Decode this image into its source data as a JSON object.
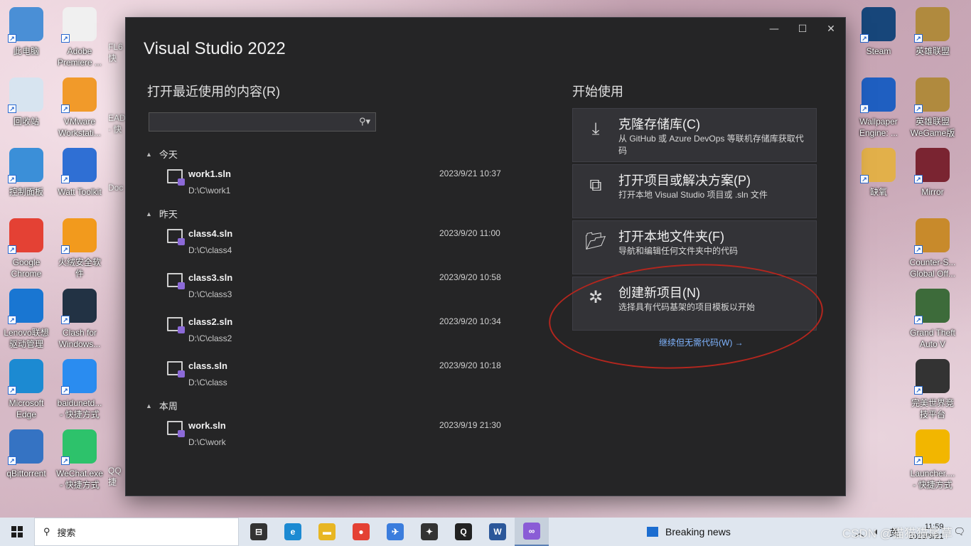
{
  "desktop": {
    "left_icons": [
      {
        "label": "此电脑",
        "icon": "computer-icon",
        "color": "#4a8fd6"
      },
      {
        "label": "Adobe\nPremiere ...",
        "icon": "document-icon",
        "color": "#f0f0f0"
      },
      {
        "label": "回收站",
        "icon": "recycle-bin-icon",
        "color": "#d7e4f0"
      },
      {
        "label": "VMware\nWorkstati...",
        "icon": "vmware-icon",
        "color": "#f19a2a"
      },
      {
        "label": "控制面板",
        "icon": "control-panel-icon",
        "color": "#3b8fd8"
      },
      {
        "label": "Watt Toolkit",
        "icon": "watt-toolkit-icon",
        "color": "#2f6fd4"
      },
      {
        "label": "Google\nChrome",
        "icon": "chrome-icon",
        "color": "#e44134"
      },
      {
        "label": "火绒安全软\n件",
        "icon": "huorong-icon",
        "color": "#f29a1d"
      },
      {
        "label": "Lenovo联想\n驱动管理",
        "icon": "lenovo-driver-icon",
        "color": "#1976d2"
      },
      {
        "label": "Clash for\nWindows...",
        "icon": "clash-icon",
        "color": "#223244"
      },
      {
        "label": "Microsoft\nEdge",
        "icon": "edge-icon",
        "color": "#1c8ad2"
      },
      {
        "label": "baidunetd...\n- 快捷方式",
        "icon": "baidu-netdisk-icon",
        "color": "#2a8cf0"
      },
      {
        "label": "qBittorrent",
        "icon": "qbittorrent-icon",
        "color": "#3573c3"
      },
      {
        "label": "WeChat.exe\n- 快捷方式",
        "icon": "wechat-icon",
        "color": "#2dc26b"
      }
    ],
    "partial_labels": [
      "FL6\n快",
      "EAD\n- 快",
      "Doc",
      "QQ\n捷"
    ],
    "right_icons": [
      {
        "label": "Steam",
        "icon": "steam-icon",
        "color": "#17467a"
      },
      {
        "label": "英雄联盟",
        "icon": "lol-icon",
        "color": "#b08a3e"
      },
      {
        "label": "Wallpaper\nEngine: ...",
        "icon": "wallpaper-engine-icon",
        "color": "#1f5fc1"
      },
      {
        "label": "英雄联盟\nWeGame版",
        "icon": "lol-wegame-icon",
        "color": "#b08a3e"
      },
      {
        "label": "缺氧",
        "icon": "oxygen-not-included-icon",
        "color": "#e2b04a"
      },
      {
        "label": "Mirror",
        "icon": "mirror-icon",
        "color": "#7a2431"
      },
      {
        "label": "Counter-S...\nGlobal Off...",
        "icon": "csgo-icon",
        "color": "#c88a2b"
      },
      {
        "label": "Grand Theft\nAuto V",
        "icon": "gta-icon",
        "color": "#3d6b3a"
      },
      {
        "label": "完美世界竞\n技平台",
        "icon": "perfect-world-icon",
        "color": "#333333"
      },
      {
        "label": "Launcher....\n- 快捷方式",
        "icon": "rockstar-launcher-icon",
        "color": "#f2b600"
      }
    ]
  },
  "vs": {
    "title": "Visual Studio 2022",
    "recent_title": "打开最近使用的内容(R)",
    "start_title": "开始使用",
    "search_value": "",
    "groups": [
      {
        "label": "今天",
        "items": [
          {
            "name": "work1.sln",
            "path": "D:\\C\\work1",
            "date": "2023/9/21 10:37"
          }
        ]
      },
      {
        "label": "昨天",
        "items": [
          {
            "name": "class4.sln",
            "path": "D:\\C\\class4",
            "date": "2023/9/20 11:00"
          },
          {
            "name": "class3.sln",
            "path": "D:\\C\\class3",
            "date": "2023/9/20 10:58"
          },
          {
            "name": "class2.sln",
            "path": "D:\\C\\class2",
            "date": "2023/9/20 10:34"
          },
          {
            "name": "class.sln",
            "path": "D:\\C\\class",
            "date": "2023/9/20 10:18"
          }
        ]
      },
      {
        "label": "本周",
        "items": [
          {
            "name": "work.sln",
            "path": "D:\\C\\work",
            "date": "2023/9/19 21:30"
          }
        ]
      }
    ],
    "actions": [
      {
        "title": "克隆存储库(C)",
        "desc": "从 GitHub 或 Azure DevOps 等联机存储库获取代码",
        "icon": "clone-download-icon"
      },
      {
        "title": "打开项目或解决方案(P)",
        "desc": "打开本地 Visual Studio 项目或 .sln 文件",
        "icon": "open-project-icon"
      },
      {
        "title": "打开本地文件夹(F)",
        "desc": "导航和编辑任何文件夹中的代码",
        "icon": "open-folder-icon"
      },
      {
        "title": "创建新项目(N)",
        "desc": "选择具有代码基架的项目模板以开始",
        "icon": "new-project-icon"
      }
    ],
    "continue_link": "继续但无需代码(W) →"
  },
  "taskbar": {
    "search_placeholder": "搜索",
    "apps": [
      {
        "icon": "task-view-icon",
        "color": "#333333",
        "glyph": "⊟"
      },
      {
        "icon": "edge-icon",
        "color": "#1c8ad2",
        "glyph": "e"
      },
      {
        "icon": "file-explorer-icon",
        "color": "#e8b623",
        "glyph": "▬"
      },
      {
        "icon": "chrome-icon",
        "color": "#e44134",
        "glyph": "●"
      },
      {
        "icon": "feishu-icon",
        "color": "#3b7ddd",
        "glyph": "✈"
      },
      {
        "icon": "perfect-world-icon",
        "color": "#333333",
        "glyph": "✦"
      },
      {
        "icon": "qq-icon",
        "color": "#222222",
        "glyph": "Q"
      },
      {
        "icon": "word-icon",
        "color": "#2b579a",
        "glyph": "W"
      },
      {
        "icon": "visual-studio-icon",
        "color": "#8a5cd6",
        "glyph": "∞",
        "active": true
      }
    ],
    "news": "Breaking news",
    "tray_lang": "英",
    "time": "11:59",
    "date": "2023/9/21",
    "watermark": "CSDN @猫猫猫尾草"
  }
}
